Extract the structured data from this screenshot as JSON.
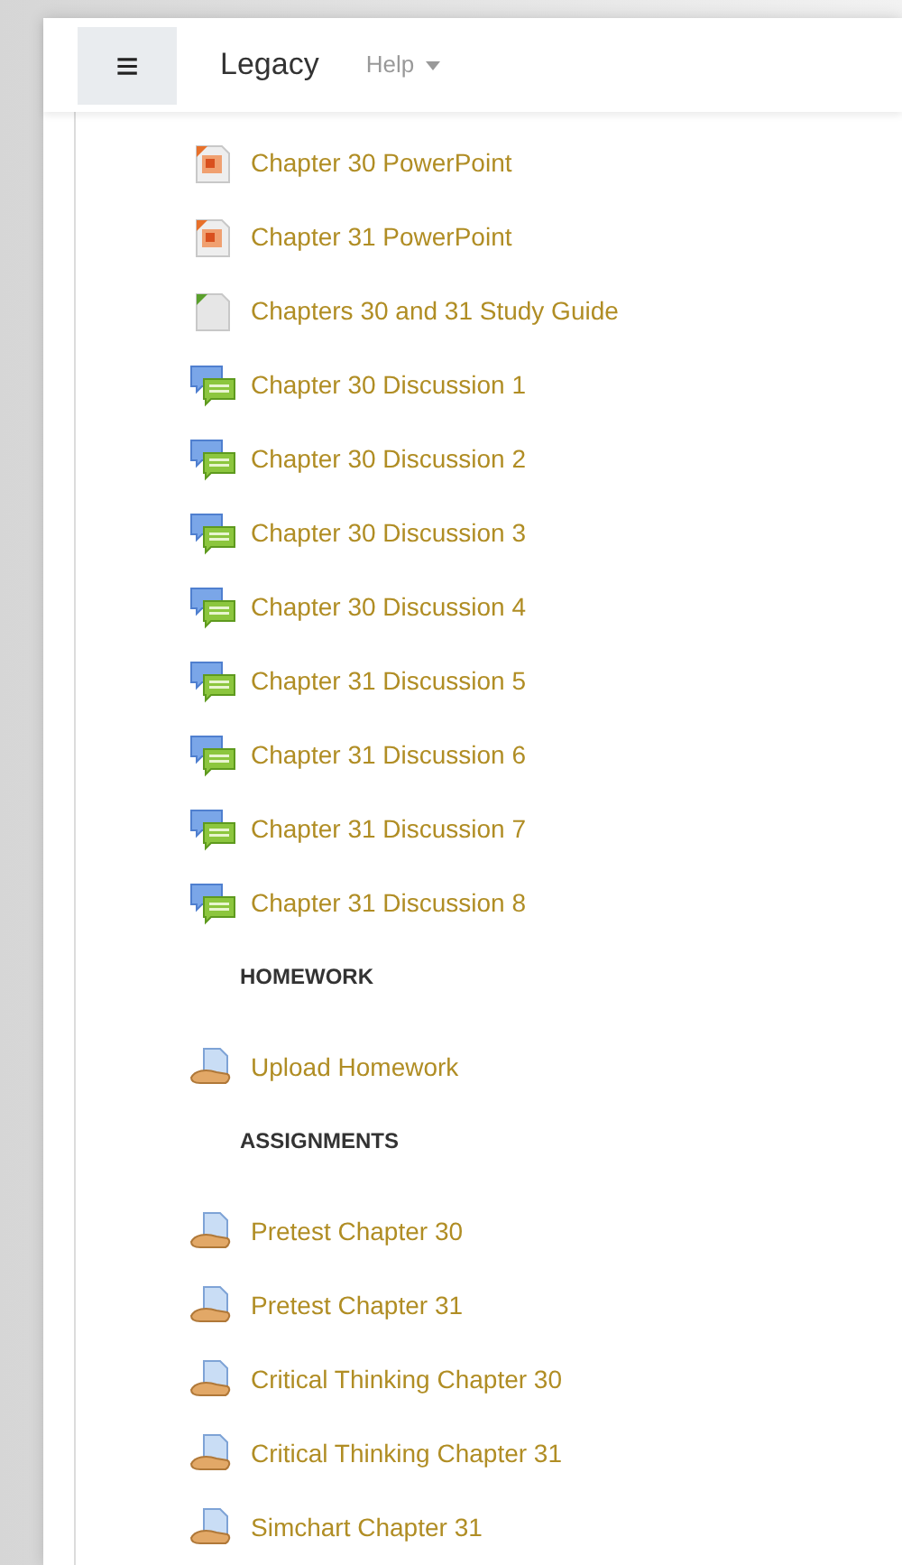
{
  "navbar": {
    "menu_button": "≡",
    "brand": "Legacy",
    "help_menu": "Help"
  },
  "items": [
    {
      "kind": "powerpoint",
      "label": "Chapter 30 PowerPoint"
    },
    {
      "kind": "powerpoint",
      "label": "Chapter 31 PowerPoint"
    },
    {
      "kind": "document",
      "label": "Chapters 30 and 31 Study Guide"
    },
    {
      "kind": "forum",
      "label": "Chapter 30 Discussion 1"
    },
    {
      "kind": "forum",
      "label": "Chapter 30 Discussion 2"
    },
    {
      "kind": "forum",
      "label": "Chapter 30 Discussion 3"
    },
    {
      "kind": "forum",
      "label": "Chapter 30 Discussion 4"
    },
    {
      "kind": "forum",
      "label": "Chapter 31 Discussion 5"
    },
    {
      "kind": "forum",
      "label": "Chapter 31 Discussion 6"
    },
    {
      "kind": "forum",
      "label": "Chapter 31 Discussion 7"
    },
    {
      "kind": "forum",
      "label": "Chapter 31 Discussion 8"
    },
    {
      "kind": "heading",
      "label": "HOMEWORK"
    },
    {
      "kind": "assignment",
      "label": "Upload Homework"
    },
    {
      "kind": "heading",
      "label": "ASSIGNMENTS"
    },
    {
      "kind": "assignment",
      "label": "Pretest Chapter 30"
    },
    {
      "kind": "assignment",
      "label": "Pretest Chapter 31"
    },
    {
      "kind": "assignment",
      "label": "Critical Thinking Chapter 30"
    },
    {
      "kind": "assignment",
      "label": "Critical Thinking Chapter 31"
    },
    {
      "kind": "assignment",
      "label": "Simchart Chapter 31"
    }
  ]
}
